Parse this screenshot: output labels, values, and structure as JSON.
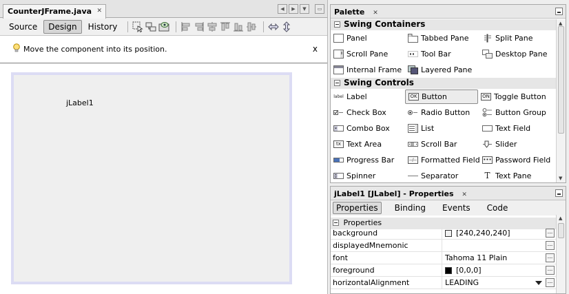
{
  "editor": {
    "file_tab": "CounterJFrame.java",
    "close_glyph": "✕",
    "views": [
      "Source",
      "Design",
      "History"
    ],
    "active_view": "Design",
    "hint": "Move the component into its position.",
    "hint_close": "x",
    "form_label": "jLabel1"
  },
  "palette": {
    "title": "Palette",
    "close_glyph": "✕",
    "categories": [
      {
        "name": "Swing Containers",
        "rows": [
          [
            {
              "label": "Panel",
              "icon": "panel-icon"
            },
            {
              "label": "Tabbed Pane",
              "icon": "tabbed-pane-icon"
            },
            {
              "label": "Split Pane",
              "icon": "split-pane-icon"
            }
          ],
          [
            {
              "label": "Scroll Pane",
              "icon": "scroll-pane-icon"
            },
            {
              "label": "Tool Bar",
              "icon": "tool-bar-icon"
            },
            {
              "label": "Desktop Pane",
              "icon": "desktop-pane-icon"
            }
          ],
          [
            {
              "label": "Internal Frame",
              "icon": "internal-frame-icon"
            },
            {
              "label": "Layered Pane",
              "icon": "layered-pane-icon"
            }
          ]
        ]
      },
      {
        "name": "Swing Controls",
        "rows": [
          [
            {
              "label": "Label",
              "icon": "label-icon",
              "glyph": "label"
            },
            {
              "label": "Button",
              "icon": "button-icon",
              "glyph": "OK",
              "selected": true
            },
            {
              "label": "Toggle Button",
              "icon": "toggle-button-icon",
              "glyph": "ON"
            }
          ],
          [
            {
              "label": "Check Box",
              "icon": "check-box-icon"
            },
            {
              "label": "Radio Button",
              "icon": "radio-button-icon"
            },
            {
              "label": "Button Group",
              "icon": "button-group-icon"
            }
          ],
          [
            {
              "label": "Combo Box",
              "icon": "combo-box-icon"
            },
            {
              "label": "List",
              "icon": "list-icon"
            },
            {
              "label": "Text Field",
              "icon": "text-field-icon"
            }
          ],
          [
            {
              "label": "Text Area",
              "icon": "text-area-icon",
              "glyph": "tx"
            },
            {
              "label": "Scroll Bar",
              "icon": "scroll-bar-icon"
            },
            {
              "label": "Slider",
              "icon": "slider-icon"
            }
          ],
          [
            {
              "label": "Progress Bar",
              "icon": "progress-bar-icon"
            },
            {
              "label": "Formatted Field",
              "icon": "formatted-field-icon",
              "glyph": "--/--"
            },
            {
              "label": "Password Field",
              "icon": "password-field-icon",
              "glyph": "•••"
            }
          ],
          [
            {
              "label": "Spinner",
              "icon": "spinner-icon"
            },
            {
              "label": "Separator",
              "icon": "separator-icon"
            },
            {
              "label": "Text Pane",
              "icon": "text-pane-icon",
              "glyph": "T"
            }
          ]
        ]
      }
    ]
  },
  "properties": {
    "title": "jLabel1 [JLabel] - Properties",
    "close_glyph": "✕",
    "tabs": [
      "Properties",
      "Binding",
      "Events",
      "Code"
    ],
    "active_tab": "Properties",
    "section": "Properties",
    "ellipsis": "...",
    "rows": [
      {
        "name": "background",
        "value": "[240,240,240]",
        "swatch": "#f0f0f0"
      },
      {
        "name": "displayedMnemonic",
        "value": ""
      },
      {
        "name": "font",
        "value": "Tahoma 11 Plain"
      },
      {
        "name": "foreground",
        "value": "[0,0,0]",
        "swatch": "#000000"
      },
      {
        "name": "horizontalAlignment",
        "value": "LEADING",
        "dropdown": true
      }
    ]
  }
}
